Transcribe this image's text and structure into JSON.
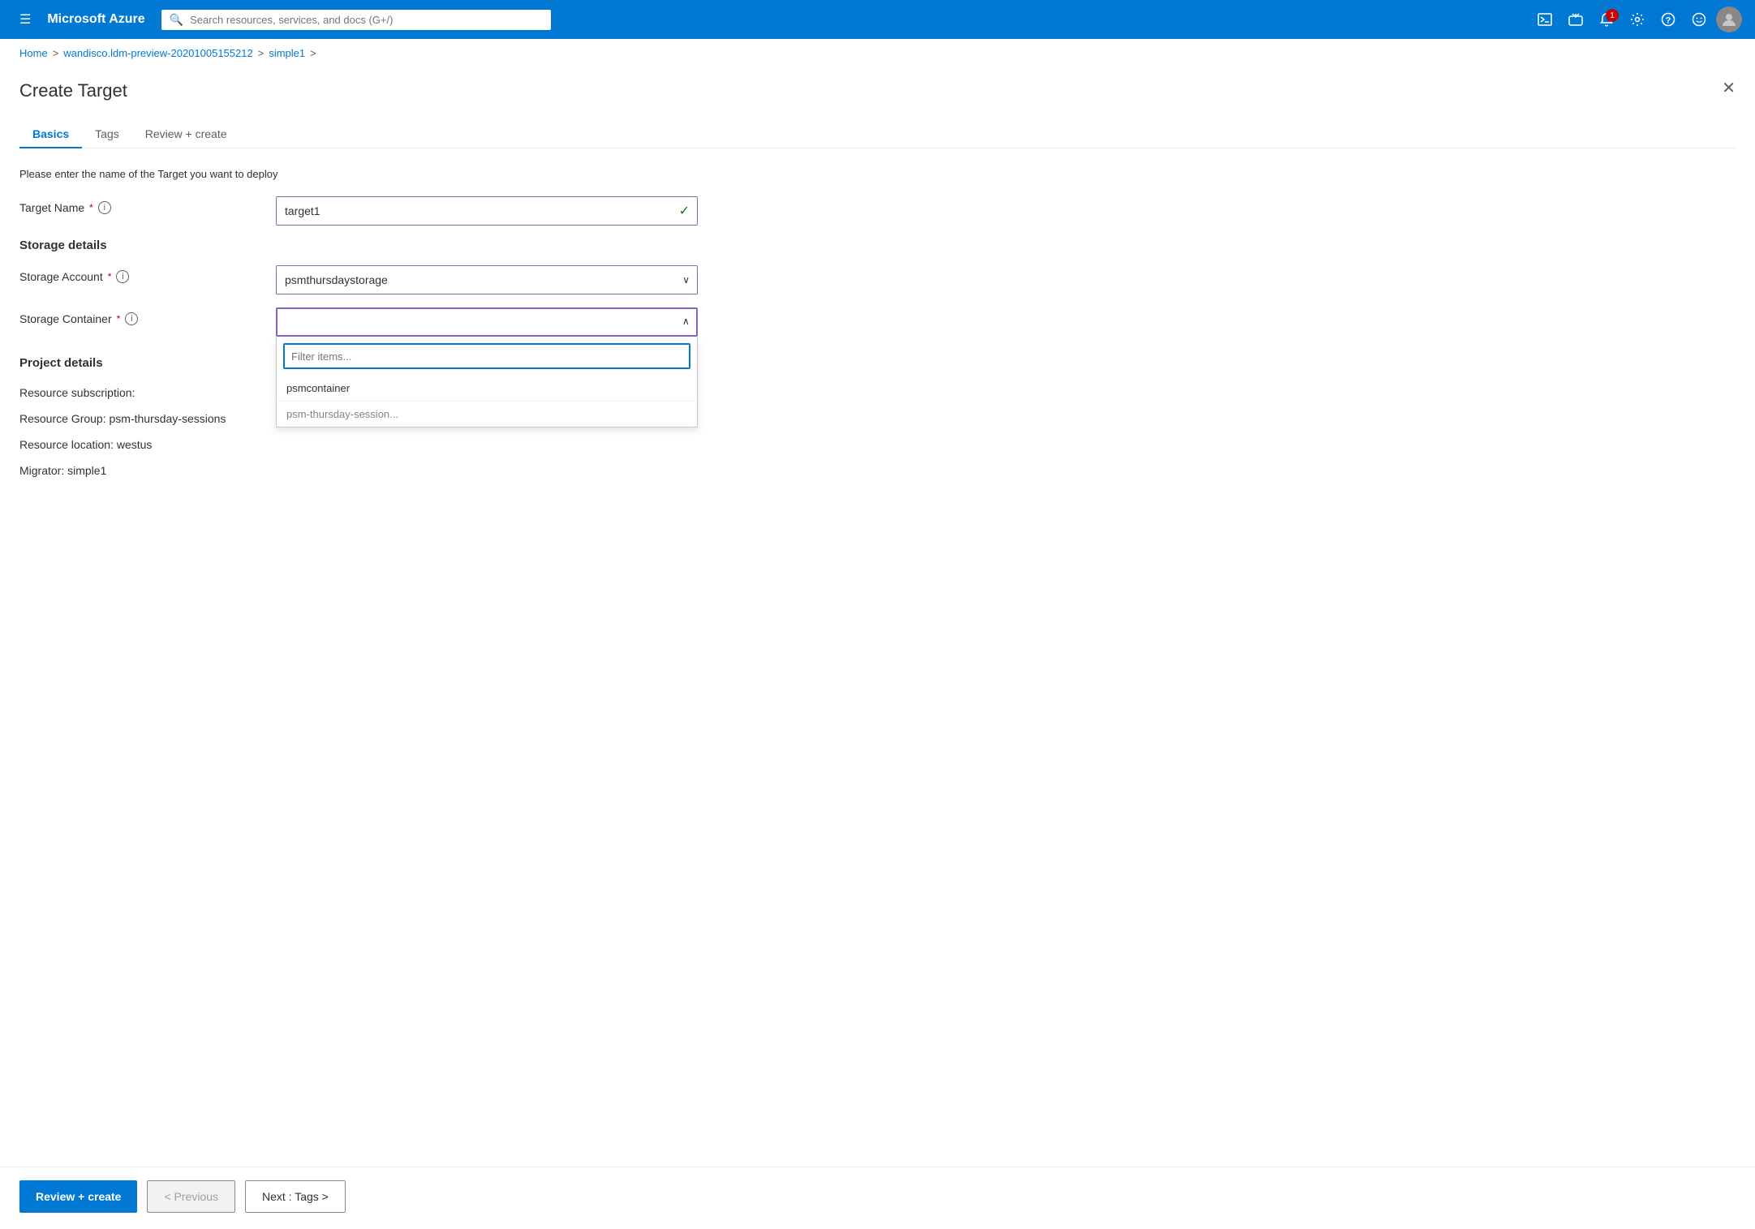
{
  "topnav": {
    "hamburger_icon": "☰",
    "brand": "Microsoft Azure",
    "search_placeholder": "Search resources, services, and docs (G+/)",
    "notification_count": "1",
    "icons": {
      "terminal": "⬛",
      "feedback": "💬",
      "bell": "🔔",
      "settings": "⚙",
      "help": "?",
      "smile": "☺"
    }
  },
  "breadcrumb": {
    "home": "Home",
    "resource_group": "wandisco.ldm-preview-20201005155212",
    "resource": "simple1"
  },
  "page": {
    "title": "Create Target",
    "close_icon": "✕"
  },
  "tabs": [
    {
      "label": "Basics",
      "active": true
    },
    {
      "label": "Tags",
      "active": false
    },
    {
      "label": "Review + create",
      "active": false
    }
  ],
  "form": {
    "description": "Please enter the name of the Target you want to deploy",
    "target_name_label": "Target Name",
    "target_name_value": "target1",
    "storage_details_heading": "Storage details",
    "storage_account_label": "Storage Account",
    "storage_account_value": "psmthursdaystorage",
    "storage_container_label": "Storage Container",
    "storage_container_value": "",
    "filter_placeholder": "Filter items...",
    "dropdown_items": [
      "psmcontainer"
    ],
    "dropdown_partial": "psm-thursday-session...",
    "project_details_heading": "Project details",
    "resource_subscription_label": "Resource subscription:",
    "resource_subscription_value": "",
    "resource_group_label": "Resource Group:",
    "resource_group_value": "psm-thursday-sessions",
    "resource_location_label": "Resource location:",
    "resource_location_value": "westus",
    "migrator_label": "Migrator:",
    "migrator_value": "simple1"
  },
  "bottom_bar": {
    "review_create_label": "Review + create",
    "previous_label": "< Previous",
    "next_label": "Next : Tags >"
  }
}
